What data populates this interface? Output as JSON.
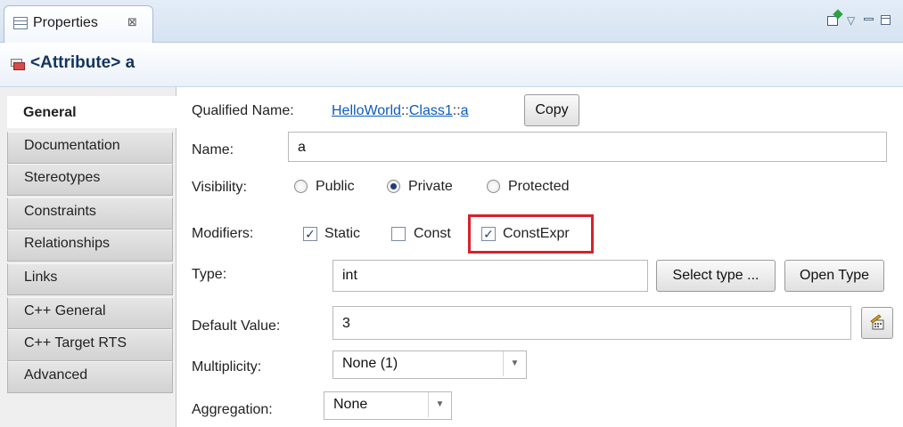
{
  "view_tab": {
    "label": "Properties",
    "close_glyph": "⊠"
  },
  "toolbar_icons": [
    "new-view-icon",
    "view-menu-icon",
    "minimize-icon",
    "maximize-icon"
  ],
  "title": {
    "icon": "attribute-icon",
    "text": "<Attribute> a"
  },
  "nav": {
    "items": [
      {
        "label": "General",
        "active": true
      },
      {
        "label": "Documentation"
      },
      {
        "label": "Stereotypes"
      },
      {
        "label": "Constraints"
      },
      {
        "label": "Relationships"
      },
      {
        "label": "Links"
      },
      {
        "label": "C++ General"
      },
      {
        "label": "C++ Target RTS"
      },
      {
        "label": "Advanced"
      }
    ]
  },
  "general": {
    "qualified_name": {
      "label": "Qualified Name:",
      "part1": "HelloWorld",
      "sep1": "::",
      "part2": "Class1",
      "sep2": "::",
      "part3": "a",
      "copy_button": "Copy"
    },
    "name": {
      "label": "Name:",
      "value": "a"
    },
    "visibility": {
      "label": "Visibility:",
      "options": [
        "Public",
        "Private",
        "Protected"
      ],
      "selected": "Private"
    },
    "modifiers": {
      "label": "Modifiers:",
      "static": {
        "label": "Static",
        "checked": true,
        "mark": "✓"
      },
      "const": {
        "label": "Const",
        "checked": false
      },
      "constexpr": {
        "label": "ConstExpr",
        "checked": true,
        "mark": "✓"
      }
    },
    "type": {
      "label": "Type:",
      "value": "int",
      "select_button": "Select type ...",
      "open_button": "Open Type"
    },
    "default_value": {
      "label": "Default Value:",
      "value": "3",
      "button_icon": "expression-editor-icon"
    },
    "multiplicity": {
      "label": "Multiplicity:",
      "value": "None (1)"
    },
    "aggregation": {
      "label": "Aggregation:",
      "value": "None"
    }
  },
  "colors": {
    "highlight": "#d7212b",
    "link": "#0b5cba",
    "title": "#14355e"
  }
}
